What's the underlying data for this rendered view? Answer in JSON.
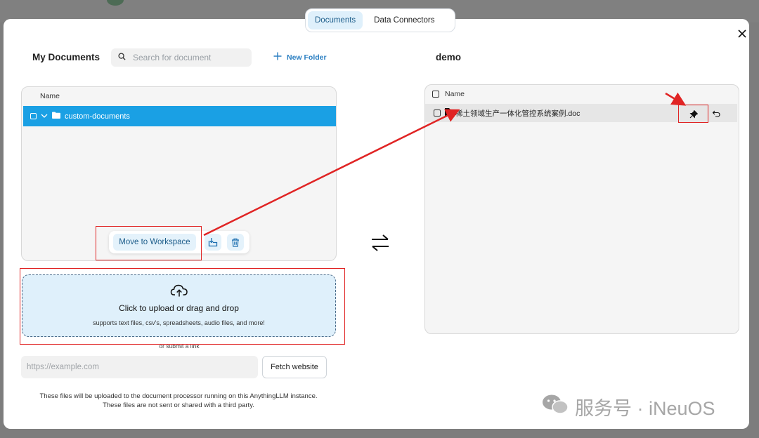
{
  "tabs": [
    {
      "label": "Documents",
      "active": true
    },
    {
      "label": "Data Connectors",
      "active": false
    }
  ],
  "left": {
    "title": "My Documents",
    "search_placeholder": "Search for document",
    "new_folder_label": "New Folder",
    "column_name": "Name",
    "folder_name": "custom-documents",
    "move_button": "Move to Workspace"
  },
  "upload": {
    "title": "Click to upload or drag and drop",
    "subtitle": "supports text files, csv's, spreadsheets, audio files, and more!",
    "submit_link_text": "or submit a link",
    "url_placeholder": "https://example.com",
    "fetch_button": "Fetch website",
    "disclaimer_line1": "These files will be uploaded to the document processor running on this AnythingLLM instance.",
    "disclaimer_line2": "These files are not sent or shared with a third party."
  },
  "right": {
    "title": "demo",
    "column_name": "Name",
    "file_name": "稀土领域生产一体化管控系统案例.doc"
  },
  "watermark": "服务号 · iNeuOS",
  "colors": {
    "accent": "#1aa0e4",
    "annotation_red": "#e02424",
    "upload_bg": "#dff0fb"
  }
}
